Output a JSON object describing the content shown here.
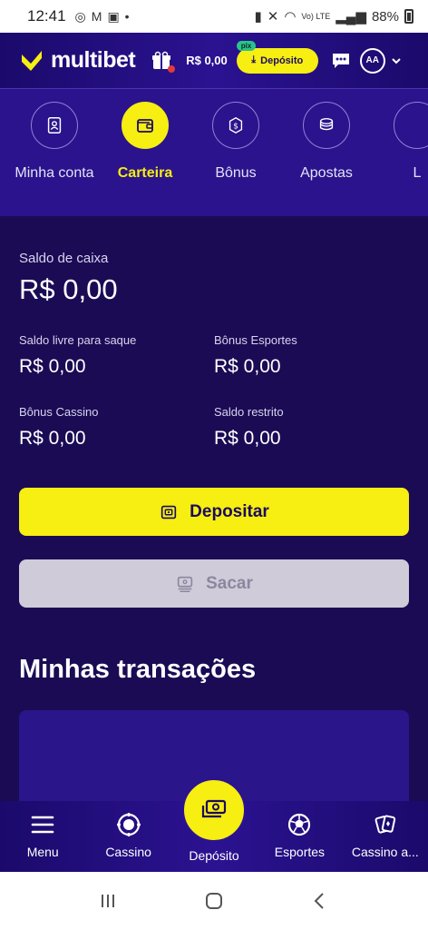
{
  "status_bar": {
    "time": "12:41",
    "battery": "88%",
    "network": "Vo) LTE"
  },
  "header": {
    "brand": "multibet",
    "balance": "R$ 0,00",
    "deposit_label": "Depósito",
    "pix_badge": "pix",
    "avatar_initials": "AA"
  },
  "tabs": [
    {
      "label": "Minha conta",
      "icon": "id-card-icon",
      "active": false
    },
    {
      "label": "Carteira",
      "icon": "wallet-icon",
      "active": true
    },
    {
      "label": "Bônus",
      "icon": "dollar-coin-icon",
      "active": false
    },
    {
      "label": "Apostas",
      "icon": "chips-stack-icon",
      "active": false
    },
    {
      "label": "L",
      "icon": "partial-icon",
      "active": false
    }
  ],
  "wallet": {
    "saldo_label": "Saldo de caixa",
    "saldo_value": "R$ 0,00",
    "items": [
      {
        "label": "Saldo livre para saque",
        "value": "R$ 0,00"
      },
      {
        "label": "Bônus Esportes",
        "value": "R$ 0,00"
      },
      {
        "label": "Bônus Cassino",
        "value": "R$ 0,00"
      },
      {
        "label": "Saldo restrito",
        "value": "R$ 0,00"
      }
    ],
    "depositar_label": "Depositar",
    "sacar_label": "Sacar"
  },
  "transactions": {
    "title": "Minhas transações"
  },
  "bottom_nav": [
    {
      "label": "Menu",
      "icon": "hamburger-icon"
    },
    {
      "label": "Cassino",
      "icon": "casino-chip-icon"
    },
    {
      "label": "Depósito",
      "icon": "money-icon"
    },
    {
      "label": "Esportes",
      "icon": "soccer-ball-icon"
    },
    {
      "label": "Cassino a...",
      "icon": "cards-icon"
    }
  ],
  "colors": {
    "accent": "#f7ee12",
    "header_bg": "#2b1291",
    "main_bg": "#1b0b55",
    "tab_bg": "#2a138c",
    "disabled_btn": "#cfcbd9"
  }
}
